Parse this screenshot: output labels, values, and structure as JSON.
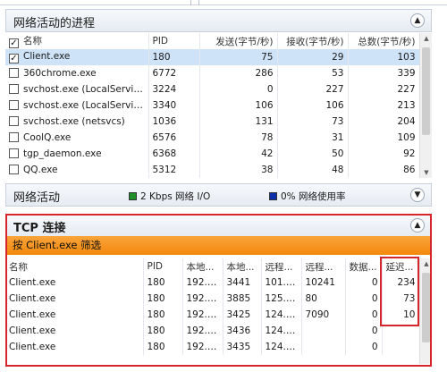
{
  "processes_section": {
    "title": "网络活动的进程",
    "columns": [
      "名称",
      "PID",
      "发送(字节/秒)",
      "接收(字节/秒)",
      "总数(字节/秒)"
    ],
    "rows": [
      {
        "checked": true,
        "name": "Client.exe",
        "pid": "180",
        "send": "75",
        "recv": "29",
        "total": "103"
      },
      {
        "checked": false,
        "name": "360chrome.exe",
        "pid": "6772",
        "send": "286",
        "recv": "53",
        "total": "339"
      },
      {
        "checked": false,
        "name": "svchost.exe (LocalServiceA...",
        "pid": "3224",
        "send": "0",
        "recv": "227",
        "total": "227"
      },
      {
        "checked": false,
        "name": "svchost.exe (LocalServiceP...",
        "pid": "3340",
        "send": "106",
        "recv": "106",
        "total": "213"
      },
      {
        "checked": false,
        "name": "svchost.exe (netsvcs)",
        "pid": "1036",
        "send": "131",
        "recv": "73",
        "total": "204"
      },
      {
        "checked": false,
        "name": "CoolQ.exe",
        "pid": "6576",
        "send": "78",
        "recv": "31",
        "total": "109"
      },
      {
        "checked": false,
        "name": "tgp_daemon.exe",
        "pid": "6368",
        "send": "42",
        "recv": "50",
        "total": "92"
      },
      {
        "checked": false,
        "name": "QQ.exe",
        "pid": "5312",
        "send": "38",
        "recv": "48",
        "total": "86"
      }
    ]
  },
  "network_section": {
    "title": "网络活动",
    "io_legend": "2 Kbps 网络 I/O",
    "usage_legend": "0% 网络使用率",
    "io_color": "#1f8f2a",
    "usage_color": "#0a2fa8"
  },
  "tcp_section": {
    "title": "TCP 连接",
    "filter_label": "按 Client.exe 筛选",
    "columns": [
      "名称",
      "PID",
      "本地...",
      "本地...",
      "远程...",
      "远程...",
      "数据...",
      "延迟..."
    ],
    "rows": [
      [
        "Client.exe",
        "180",
        "192.1...",
        "3441",
        "101.2...",
        "10241",
        "0",
        "234"
      ],
      [
        "Client.exe",
        "180",
        "192.1...",
        "3885",
        "125.3...",
        "80",
        "0",
        "73"
      ],
      [
        "Client.exe",
        "180",
        "192.1...",
        "3425",
        "124.1...",
        "7090",
        "0",
        "10"
      ],
      [
        "Client.exe",
        "180",
        "192.1...",
        "3436",
        "124.1...",
        "",
        "0",
        ""
      ],
      [
        "Client.exe",
        "180",
        "192.1...",
        "3435",
        "124.1...",
        "",
        "0",
        ""
      ]
    ]
  },
  "accent": {
    "highlight": "#d6262c",
    "selected_row": "#cfe3f8",
    "filter_bar": "#f3880d"
  }
}
